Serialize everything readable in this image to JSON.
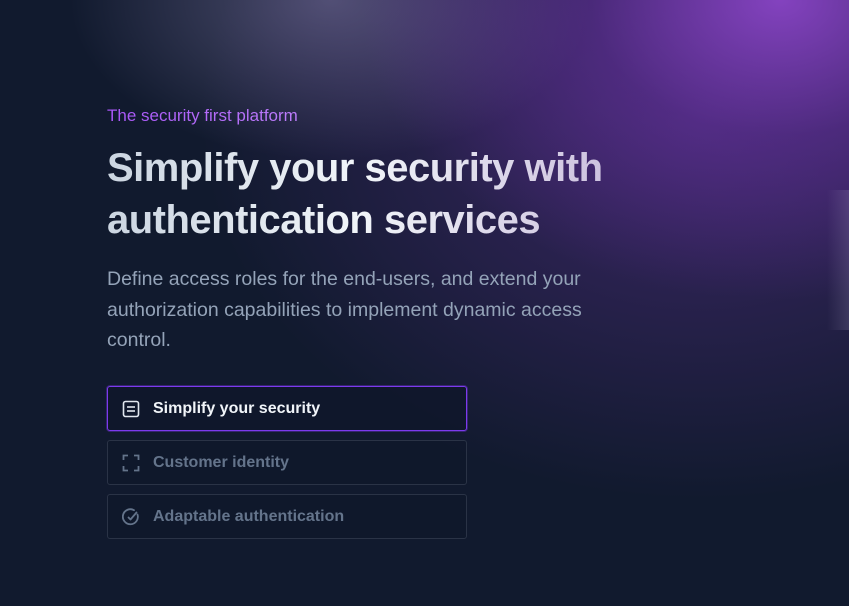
{
  "hero": {
    "eyebrow": "The security first platform",
    "title": "Simplify your security with authentication services",
    "description": "Define access roles for the end-users, and extend your authorization capabilities to implement dynamic access control."
  },
  "tabs": [
    {
      "label": "Simplify your security",
      "icon": "document-icon",
      "active": true
    },
    {
      "label": "Customer identity",
      "icon": "scan-frame-icon",
      "active": false
    },
    {
      "label": "Adaptable authentication",
      "icon": "check-circle-icon",
      "active": false
    }
  ],
  "colors": {
    "background": "#111a2e",
    "accent": "#7c3aed",
    "eyebrow": "#a855f7",
    "glow": "#9348d2",
    "muted_text": "#94a3b8"
  }
}
